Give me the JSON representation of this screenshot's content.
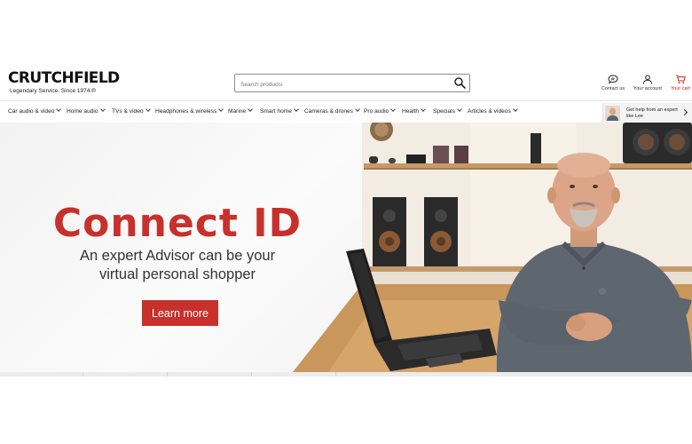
{
  "brand": {
    "name": "CRUTCHFIELD",
    "tagline": "Legendary Service. Since 1974.®"
  },
  "search": {
    "placeholder": "Search products"
  },
  "utility": {
    "contact_label": "Contact us",
    "account_label": "Your account",
    "cart_label": "Your cart"
  },
  "nav": {
    "items": [
      {
        "label": "Car audio & video"
      },
      {
        "label": "Home audio"
      },
      {
        "label": "TVs & video"
      },
      {
        "label": "Headphones & wireless"
      },
      {
        "label": "Marine"
      },
      {
        "label": "Smart home"
      },
      {
        "label": "Cameras & drones"
      },
      {
        "label": "Pro audio"
      },
      {
        "label": "Health"
      },
      {
        "label": "Specials"
      },
      {
        "label": "Articles & videos"
      }
    ]
  },
  "expert": {
    "line1": "Get help from an expert",
    "line2": "like Lee"
  },
  "hero": {
    "title": "Connect ID",
    "subtitle_line1": "An expert Advisor can be your",
    "subtitle_line2": "virtual personal shopper",
    "cta_label": "Learn more"
  },
  "colors": {
    "brand_red": "#c8302b",
    "cart_red": "#c8201f",
    "text": "#222222"
  },
  "icons": {
    "search": "magnifier-icon",
    "contact": "chat-bubble-icon",
    "account": "person-icon",
    "cart": "shopping-cart-icon"
  }
}
